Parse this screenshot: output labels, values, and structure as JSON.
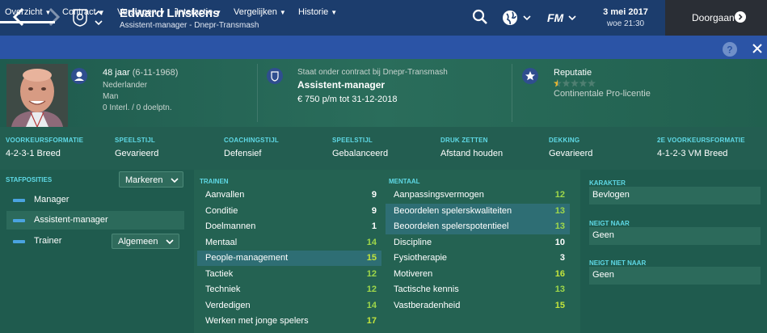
{
  "header": {
    "name": "Edward Linskens",
    "subtitle": "Assistent-manager - Dnepr-Transmash",
    "date": "3 mei 2017",
    "day_time": "woe 21:30",
    "continue_label": "Doorgaan",
    "fm_label": "FM"
  },
  "tabs": [
    {
      "label": "Overzicht"
    },
    {
      "label": "Contract"
    },
    {
      "label": "Verslagen"
    },
    {
      "label": "Interactie"
    },
    {
      "label": "Vergelijken"
    },
    {
      "label": "Historie"
    }
  ],
  "profile": {
    "age": "48 jaar",
    "dob": "(6-11-1968)",
    "nationality": "Nederlander",
    "gender": "Man",
    "caps": "0 Interl. / 0 doelptn.",
    "contract_head": "Staat onder contract bij Dnepr-Transmash",
    "role": "Assistent-manager",
    "salary": "€ 750 p/m tot 31-12-2018",
    "reputation_title": "Reputatie",
    "reputation_stars": 0.5,
    "licence": "Continentale Pro-licentie"
  },
  "styles": [
    {
      "head": "VOORKEURSFORMATIE",
      "value": "4-2-3-1 Breed"
    },
    {
      "head": "SPEELSTIJL",
      "value": "Gevarieerd"
    },
    {
      "head": "COACHINGSTIJL",
      "value": "Defensief"
    },
    {
      "head": "SPEELSTIJL",
      "value": "Gebalanceerd"
    },
    {
      "head": "DRUK ZETTEN",
      "value": "Afstand houden"
    },
    {
      "head": "DEKKING",
      "value": "Gevarieerd"
    },
    {
      "head": "2E VOORKEURSFORMATIE",
      "value": "4-1-2-3 VM Breed"
    }
  ],
  "staff": {
    "head": "STAFPOSITIES",
    "markeren": "Markeren",
    "rows": [
      {
        "label": "Manager"
      },
      {
        "label": "Assistent-manager"
      },
      {
        "label": "Trainer"
      }
    ],
    "algemeen": "Algemeen"
  },
  "training": {
    "head": "TRAINEN",
    "rows": [
      {
        "name": "Aanvallen",
        "value": "9"
      },
      {
        "name": "Conditie",
        "value": "9"
      },
      {
        "name": "Doelmannen",
        "value": "1"
      },
      {
        "name": "Mentaal",
        "value": "14"
      },
      {
        "name": "People-management",
        "value": "15"
      },
      {
        "name": "Tactiek",
        "value": "12"
      },
      {
        "name": "Techniek",
        "value": "12"
      },
      {
        "name": "Verdedigen",
        "value": "14"
      },
      {
        "name": "Werken met jonge spelers",
        "value": "17"
      }
    ]
  },
  "mental": {
    "head": "MENTAAL",
    "rows": [
      {
        "name": "Aanpassingsvermogen",
        "value": "12"
      },
      {
        "name": "Beoordelen spelerskwaliteiten",
        "value": "13"
      },
      {
        "name": "Beoordelen spelerspotentieel",
        "value": "13"
      },
      {
        "name": "Discipline",
        "value": "10"
      },
      {
        "name": "Fysiotherapie",
        "value": "3"
      },
      {
        "name": "Motiveren",
        "value": "16"
      },
      {
        "name": "Tactische kennis",
        "value": "13"
      },
      {
        "name": "Vastberadenheid",
        "value": "15"
      }
    ]
  },
  "traits": {
    "character_head": "KARAKTER",
    "character": "Bevlogen",
    "tends_head": "NEIGT NAAR",
    "tends": "Geen",
    "not_tends_head": "NEIGT NIET NAAR",
    "not_tends": "Geen"
  },
  "colors": {
    "topbar": "#1c3d6d",
    "tabbar": "#2b54a6",
    "accent_cyan": "#5fd9e6",
    "attr_high": "#c3e43c",
    "background": "#1f5b4e"
  }
}
